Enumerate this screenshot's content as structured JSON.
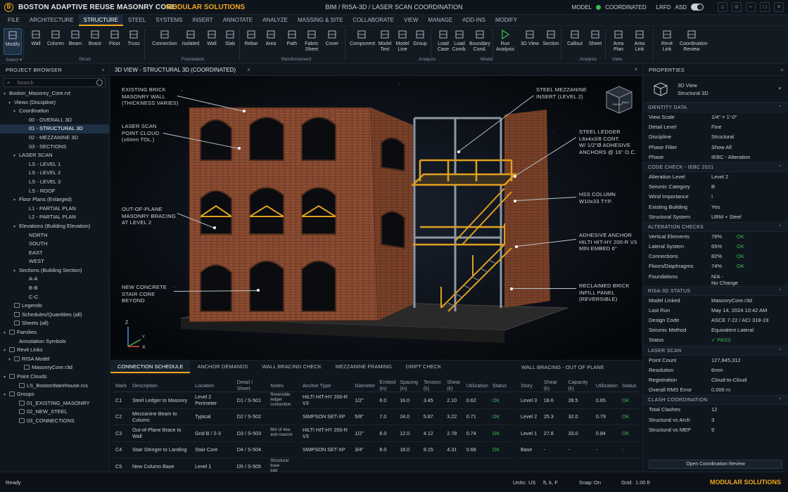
{
  "app": {
    "title": "BOSTON ADAPTIVE REUSE MASONRY CORE",
    "brand": "MODULAR SOLUTIONS",
    "logo_letter": "B",
    "center_title": "BIM / RISA-3D / LASER SCAN COORDINATION",
    "model_label": "MODEL",
    "model_status": "COORDINATED",
    "lrfd": "LRFD",
    "asd": "ASD"
  },
  "menu": [
    "FILE",
    "ARCHITECTURE",
    "STRUCTURE",
    "STEEL",
    "SYSTEMS",
    "INSERT",
    "ANNOTATE",
    "ANALYZE",
    "MASSING & SITE",
    "COLLABORATE",
    "VIEW",
    "MANAGE",
    "ADD-INS",
    "MODIFY"
  ],
  "menu_active": "STRUCTURE",
  "ribbon": {
    "buttons": [
      {
        "label": "Modify",
        "icon": "cursor-icon"
      },
      {
        "label": "Wall",
        "icon": "wall-icon"
      },
      {
        "label": "Column",
        "icon": "column-icon"
      },
      {
        "label": "Beam",
        "icon": "beam-icon"
      },
      {
        "label": "Brace",
        "icon": "brace-icon"
      },
      {
        "label": "Floor",
        "icon": "floor-icon"
      },
      {
        "label": "Truss",
        "icon": "truss-icon"
      },
      {
        "label": "Connection",
        "icon": "connection-icon"
      },
      {
        "label": "Isolated",
        "icon": "isolated-footing-icon"
      },
      {
        "label": "Wall",
        "icon": "wall-footing-icon"
      },
      {
        "label": "Slab",
        "icon": "slab-icon"
      },
      {
        "label": "Rebar",
        "icon": "rebar-icon"
      },
      {
        "label": "Area",
        "icon": "area-icon"
      },
      {
        "label": "Path",
        "icon": "path-icon"
      },
      {
        "label": "Fabric Sheet",
        "icon": "fabric-sheet-icon"
      },
      {
        "label": "Cover",
        "icon": "cover-icon"
      },
      {
        "label": "Component",
        "icon": "component-icon"
      },
      {
        "label": "Model Text",
        "icon": "model-text-icon"
      },
      {
        "label": "Model Line",
        "icon": "model-line-icon"
      },
      {
        "label": "Group",
        "icon": "group-icon"
      },
      {
        "label": "Load Case",
        "icon": "load-case-icon"
      },
      {
        "label": "Load Comb.",
        "icon": "load-comb-icon"
      },
      {
        "label": "Boundary Cond.",
        "icon": "boundary-icon"
      },
      {
        "label": "Run Analysis",
        "icon": "play-icon"
      },
      {
        "label": "3D View",
        "icon": "cube-icon"
      },
      {
        "label": "Section",
        "icon": "section-icon"
      },
      {
        "label": "Callout",
        "icon": "callout-icon"
      },
      {
        "label": "Sheet",
        "icon": "sheet-icon"
      },
      {
        "label": "Area Plan",
        "icon": "area-plan-icon"
      },
      {
        "label": "Area Link",
        "icon": "area-link-icon"
      },
      {
        "label": "Revit Link",
        "icon": "revit-link-icon"
      },
      {
        "label": "Coordination Review",
        "icon": "coordination-icon"
      }
    ],
    "groups": [
      "Select ▾",
      "Struct",
      "Foundation",
      "Reinforcement",
      "Analysis",
      "Model",
      "Analysis",
      "View"
    ]
  },
  "browser": {
    "title": "PROJECT BROWSER",
    "search_placeholder": "Search",
    "items": [
      {
        "label": "Boston_Masonry_Core.rvt",
        "indent": 0,
        "caret": "▾"
      },
      {
        "label": "Views (Discipline)",
        "indent": 1,
        "caret": "▾"
      },
      {
        "label": "Coordination",
        "indent": 2,
        "caret": "▾"
      },
      {
        "label": "00 - OVERALL 3D",
        "indent": 4,
        "caret": ""
      },
      {
        "label": "01 - STRUCTURAL 3D",
        "indent": 4,
        "caret": "",
        "selected": true
      },
      {
        "label": "02 - MEZZANINE 3D",
        "indent": 4,
        "caret": ""
      },
      {
        "label": "03 - SECTIONS",
        "indent": 4,
        "caret": ""
      },
      {
        "label": "LASER SCAN",
        "indent": 2,
        "caret": "▾"
      },
      {
        "label": "LS - LEVEL 1",
        "indent": 4,
        "caret": ""
      },
      {
        "label": "LS - LEVEL 2",
        "indent": 4,
        "caret": ""
      },
      {
        "label": "LS - LEVEL 3",
        "indent": 4,
        "caret": ""
      },
      {
        "label": "LS - ROOF",
        "indent": 4,
        "caret": ""
      },
      {
        "label": "Floor Plans (Enlarged)",
        "indent": 2,
        "caret": "▾"
      },
      {
        "label": "L1 - PARTIAL PLAN",
        "indent": 4,
        "caret": ""
      },
      {
        "label": "L2 - PARTIAL PLAN",
        "indent": 4,
        "caret": ""
      },
      {
        "label": "Elevations (Building Elevation)",
        "indent": 2,
        "caret": "▾"
      },
      {
        "label": "NORTH",
        "indent": 4,
        "caret": ""
      },
      {
        "label": "SOUTH",
        "indent": 4,
        "caret": ""
      },
      {
        "label": "EAST",
        "indent": 4,
        "caret": ""
      },
      {
        "label": "WEST",
        "indent": 4,
        "caret": ""
      },
      {
        "label": "Sections (Building Section)",
        "indent": 2,
        "caret": "▾"
      },
      {
        "label": "A-A",
        "indent": 4,
        "caret": ""
      },
      {
        "label": "B-B",
        "indent": 4,
        "caret": ""
      },
      {
        "label": "C-C",
        "indent": 4,
        "caret": ""
      },
      {
        "label": "Legends",
        "indent": 1,
        "caret": "",
        "icon": true
      },
      {
        "label": "Schedules/Quantities (all)",
        "indent": 1,
        "caret": "",
        "icon": true
      },
      {
        "label": "Sheets (all)",
        "indent": 1,
        "caret": "",
        "icon": true
      },
      {
        "label": "Families",
        "indent": 0,
        "caret": "▾",
        "icon": true
      },
      {
        "label": "Annotation Symbols",
        "indent": 2,
        "caret": ""
      },
      {
        "label": "Revit Links",
        "indent": 0,
        "caret": "▾",
        "icon": true
      },
      {
        "label": "RISA Model",
        "indent": 1,
        "caret": "▾",
        "icon": true
      },
      {
        "label": "MasonryCore.r3d",
        "indent": 3,
        "caret": "",
        "icon": true
      },
      {
        "label": "Point Clouds",
        "indent": 0,
        "caret": "▾",
        "icon": true
      },
      {
        "label": "LS_BostonWarehouse.rcs",
        "indent": 2,
        "caret": "",
        "icon": true
      },
      {
        "label": "Groups",
        "indent": 0,
        "caret": "▾",
        "icon": true
      },
      {
        "label": "01_EXISTING_MASONRY",
        "indent": 2,
        "caret": "",
        "icon": true
      },
      {
        "label": "02_NEW_STEEL",
        "indent": 2,
        "caret": "",
        "icon": true
      },
      {
        "label": "03_CONNECTIONS",
        "indent": 2,
        "caret": "",
        "icon": true
      }
    ]
  },
  "viewport": {
    "title": "3D VIEW - STRUCTURAL 3D (COORDINATED)",
    "viewcube_front": "FRONT",
    "viewcube_back": "BACK",
    "axes": {
      "z": "Z",
      "y": "Y",
      "x": "X"
    },
    "callouts": [
      {
        "text": "EXISTING BRICK\nMASONRY WALL\n(THICKNESS VARIES)"
      },
      {
        "text": "LASER SCAN\nPOINT CLOUD\n(±6mm TOL.)"
      },
      {
        "text": "OUT-OF-PLANE\nMASONRY BRACING\nAT LEVEL 2"
      },
      {
        "text": "NEW CONCRETE\nSTAIR CORE\nBEYOND"
      },
      {
        "text": "STEEL MEZZANINE\nINSERT (LEVEL 2)"
      },
      {
        "text": "STEEL LEDGER\nL6x4x3/8 CONT.\nW/ 1/2\"Ø ADHESIVE\nANCHORS @ 16\" O.C."
      },
      {
        "text": "HSS COLUMN\nW10x33 TYP."
      },
      {
        "text": "ADHESIVE ANCHOR\nHILTI HIT-HY 200-R V3\nMIN EMBED 6\""
      },
      {
        "text": "RECLAIMED BRICK\nINFILL PANEL\n(REVERSIBLE)"
      }
    ]
  },
  "bottom": {
    "tabs": [
      "CONNECTION SCHEDULE",
      "ANCHOR DEMANDS",
      "WALL BRACING CHECK",
      "MEZZANINE FRAMING",
      "DRIFT CHECK"
    ],
    "schedule_headers": [
      "Mark",
      "Description",
      "Location",
      "Detail / Sheet",
      "Notes"
    ],
    "schedule_rows": [
      [
        "C1",
        "Steel Ledger to Masonry",
        "Level 2 Perimeter",
        "D1 / S-501",
        "Reversible\nledger\nconnection"
      ],
      [
        "C2",
        "Mezzanine Beam to Column",
        "Typical",
        "D2 / S-502",
        ""
      ],
      [
        "C3",
        "Out-of-Plane Brace to Wall",
        "Grid B / 2-3",
        "D3 / S-503",
        "Min of 4ea\nand masonr"
      ],
      [
        "C4",
        "Stair Stringer to Landing",
        "Stair Core",
        "D4 / S-504",
        ""
      ],
      [
        "C5",
        "New Column Base",
        "Level 1",
        "D5 / S-505",
        "Structural\nbase\npad"
      ]
    ],
    "anchor_headers": [
      "Anchor Type",
      "Diameter",
      "Embed (in)",
      "Spacing (in)",
      "Tension (k)",
      "Shear (k)",
      "Utilization",
      "Status"
    ],
    "anchor_rows": [
      [
        "HILTI HIT-HY 200-R V3",
        "1/2\"",
        "6.0",
        "16.0",
        "3.45",
        "2.10",
        "0.62",
        "OK"
      ],
      [
        "SIMPSON SET-XP",
        "5/8\"",
        "7.0",
        "24.0",
        "5.87",
        "3.22",
        "0.71",
        "OK"
      ],
      [
        "HILTI HIT-HY 200-R V3",
        "1/2\"",
        "6.0",
        "12.0",
        "4.12",
        "2.78",
        "0.74",
        "OK"
      ],
      [
        "SIMPSON SET-XP",
        "3/4\"",
        "8.0",
        "18.0",
        "8.15",
        "4.31",
        "0.68",
        "OK"
      ]
    ],
    "bracing_title": "WALL BRACING - OUT OF PLANE",
    "bracing_headers": [
      "Story",
      "Shear (k)",
      "Capacity (k)",
      "Utilization",
      "Status"
    ],
    "bracing_rows": [
      [
        "Level 3",
        "18.6",
        "28.5",
        "0.65",
        "OK"
      ],
      [
        "Level 2",
        "25.3",
        "32.0",
        "0.79",
        "OK"
      ],
      [
        "Level 1",
        "27.8",
        "33.0",
        "0.84",
        "OK"
      ],
      [
        "Base",
        "-",
        "-",
        "-",
        "-"
      ]
    ]
  },
  "props": {
    "title": "PROPERTIES",
    "type_name": "3D View",
    "type_sub": "Structural 3D",
    "sections": [
      {
        "title": "IDENTITY DATA",
        "rows": [
          [
            "View Scale",
            "1/4\" = 1'-0\""
          ],
          [
            "Detail Level",
            "Fine"
          ],
          [
            "Discipline",
            "Structural"
          ],
          [
            "Phase Filter",
            "Show All"
          ],
          [
            "Phase",
            "IEBC - Alteration"
          ]
        ]
      },
      {
        "title": "CODE CHECK - IEBC 2021",
        "rows": [
          [
            "Alteration Level",
            "Level 2"
          ],
          [
            "Seismic Category",
            "B"
          ],
          [
            "Wind Importance",
            "I"
          ],
          [
            "Existing Building",
            "Yes"
          ],
          [
            "Structural System",
            "URM + Steel"
          ]
        ]
      },
      {
        "title": "ALTERATION CHECKS",
        "rows": [
          [
            "Vertical Elements",
            "78%",
            "OK"
          ],
          [
            "Lateral System",
            "65%",
            "OK"
          ],
          [
            "Connections",
            "82%",
            "OK"
          ],
          [
            "Floors/Diaphragms",
            "74%",
            "OK"
          ],
          [
            "Foundations",
            "N/A -\nNo Change"
          ]
        ]
      },
      {
        "title": "RISA-3D STATUS",
        "rows": [
          [
            "Model Linked",
            "MasonryCore.r3d"
          ],
          [
            "Last Run",
            "May 14, 2024 10:42 AM"
          ],
          [
            "Design Code",
            "ASCE 7-22 / ACI 318-19"
          ],
          [
            "Seismic Method",
            "Equivalent Lateral"
          ],
          [
            "Status",
            "✓  PASS"
          ]
        ]
      },
      {
        "title": "LASER SCAN",
        "rows": [
          [
            "Point Count",
            "127,845,312"
          ],
          [
            "Resolution",
            "6mm"
          ],
          [
            "Registration",
            "Cloud-to-Cloud"
          ],
          [
            "Overall RMS Error",
            "0.006 m"
          ]
        ]
      },
      {
        "title": "CLASH COORDINATION",
        "rows": [
          [
            "Total Clashes",
            "12"
          ],
          [
            "Structural vs Arch",
            "3"
          ],
          [
            "Structural vs MEP",
            "9"
          ]
        ]
      }
    ],
    "button": "Open Coordination Review"
  },
  "status": {
    "ready": "Ready",
    "units_label": "Units:",
    "units_value": "US",
    "units_sub": "ft, k, F",
    "snap_label": "Snap:",
    "snap_value": "On",
    "grid_label": "Grid:",
    "grid_value": "1.00 ft",
    "brand": "MODULAR SOLUTIONS"
  },
  "colors": {
    "accent": "#f2a91e",
    "ok": "#3fb950",
    "panel": "#0f161d",
    "selection": "#1e3044"
  }
}
